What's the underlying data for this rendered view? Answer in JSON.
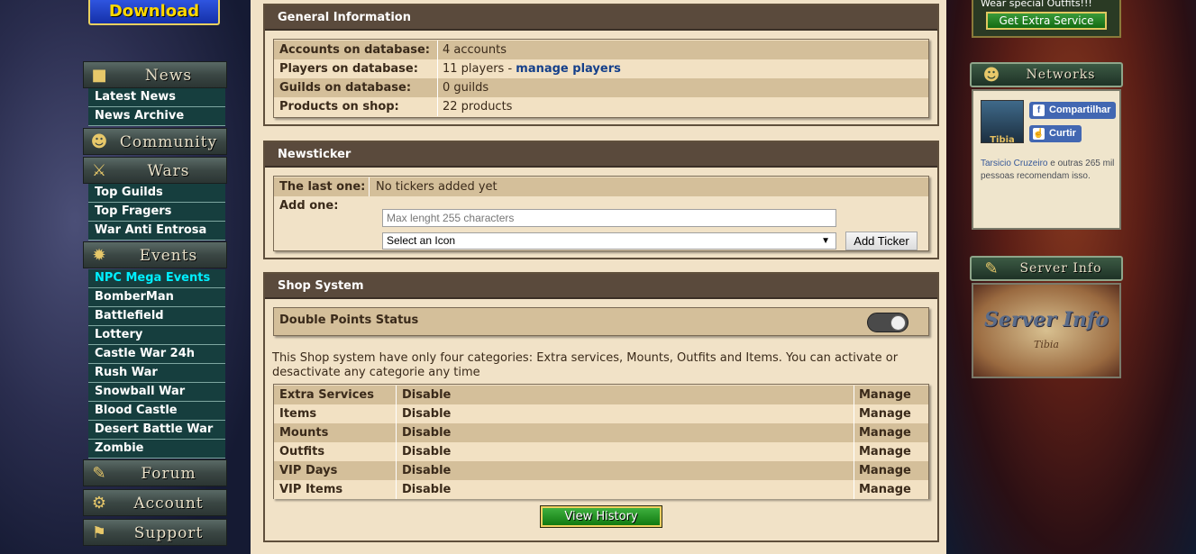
{
  "sidebar": {
    "download_label": "Download",
    "sections": {
      "news": {
        "title": "News",
        "icon": "news-scroll-icon"
      },
      "community": {
        "title": "Community",
        "icon": "community-icon"
      },
      "wars": {
        "title": "Wars",
        "icon": "crossed-swords-icon"
      },
      "events": {
        "title": "Events",
        "icon": "events-icon"
      },
      "forum": {
        "title": "Forum",
        "icon": "forum-quill-icon"
      },
      "account": {
        "title": "Account",
        "icon": "account-icon"
      },
      "support": {
        "title": "Support",
        "icon": "support-icon"
      }
    },
    "news_items": [
      "Latest News",
      "News Archive"
    ],
    "wars_items": [
      "Top Guilds",
      "Top Fragers",
      "War Anti Entrosa"
    ],
    "events_items": [
      "NPC Mega Events",
      "BomberMan",
      "Battlefield",
      "Lottery",
      "Castle War 24h",
      "Rush War",
      "Snowball War",
      "Blood Castle",
      "Desert Battle War",
      "Zombie"
    ]
  },
  "general": {
    "title": "General Information",
    "rows": [
      {
        "label": "Accounts on database:",
        "value": "4 accounts"
      },
      {
        "label": "Players on database:",
        "value": "11 players - ",
        "link": "manage players"
      },
      {
        "label": "Guilds on database:",
        "value": "0 guilds"
      },
      {
        "label": "Products on shop:",
        "value": "22 products"
      }
    ]
  },
  "newsticker": {
    "title": "Newsticker",
    "last_label": "The last one:",
    "last_value": "No tickers added yet",
    "add_label": "Add one:",
    "input_placeholder": "Max lenght 255 characters",
    "select_value": "Select an Icon",
    "add_button": "Add Ticker"
  },
  "shop": {
    "title": "Shop System",
    "double_points_label": "Double Points Status",
    "double_points_on": true,
    "description": "This Shop system have only four categories: Extra services, Mounts, Outfits and Items. You can activate or desactivate any categorie any time",
    "categories": [
      {
        "name": "Extra Services",
        "action": "Disable",
        "manage": "Manage"
      },
      {
        "name": "Items",
        "action": "Disable",
        "manage": "Manage"
      },
      {
        "name": "Mounts",
        "action": "Disable",
        "manage": "Manage"
      },
      {
        "name": "Outfits",
        "action": "Disable",
        "manage": "Manage"
      },
      {
        "name": "VIP Days",
        "action": "Disable",
        "manage": "Manage"
      },
      {
        "name": "VIP Items",
        "action": "Disable",
        "manage": "Manage"
      }
    ],
    "view_history": "View History"
  },
  "right": {
    "promo_text": "Wear special Outfits!!!",
    "promo_button": "Get Extra Service",
    "networks_title": "Networks",
    "page_name": "Tibia",
    "share_label": "Compartilhar",
    "like_label": "Curtir",
    "friend_name": "Tarsicio Cruzeiro",
    "recommend_text": " e outras 265 mil pessoas recomendam isso.",
    "server_info_title": "Server Info",
    "server_info_banner": "Server Info",
    "server_info_banner_sub": "Tibia"
  },
  "colors": {
    "panel_header": "#5a4a3c",
    "row_dark": "#d4bf9a",
    "row_light": "#f2e1c3",
    "link": "#15408a",
    "menu_item_bg": "#163e3e",
    "active_menu": "#00f0ff"
  }
}
